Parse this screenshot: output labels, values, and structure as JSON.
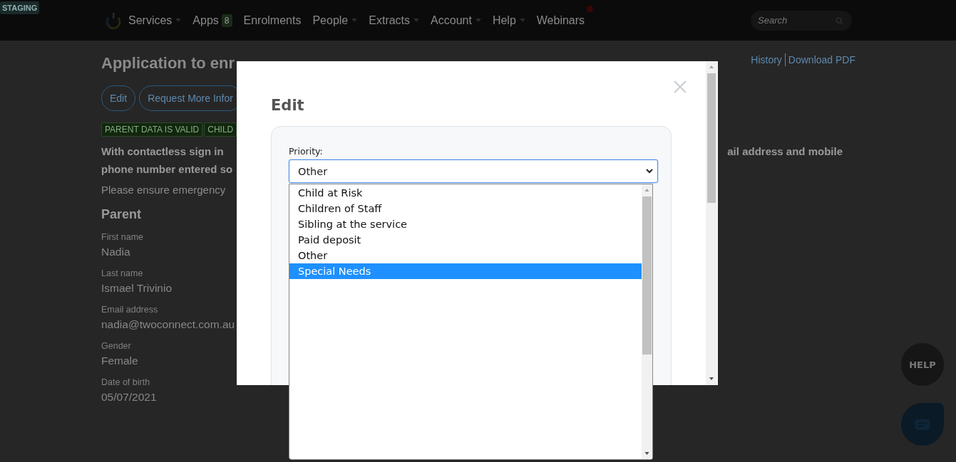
{
  "staging_badge": "STAGING",
  "nav": {
    "items": [
      {
        "label": "Services",
        "kind": "dropdown"
      },
      {
        "label": "Apps",
        "kind": "badge",
        "badge": "8"
      },
      {
        "label": "Enrolments",
        "kind": "link"
      },
      {
        "label": "People",
        "kind": "dropdown"
      },
      {
        "label": "Extracts",
        "kind": "dropdown"
      },
      {
        "label": "Account",
        "kind": "dropdown"
      },
      {
        "label": "Help",
        "kind": "dropdown"
      },
      {
        "label": "Webinars",
        "kind": "notify"
      }
    ],
    "search": {
      "placeholder": "Search"
    }
  },
  "page": {
    "title": "Application to enr",
    "links": [
      "History",
      "Download PDF"
    ],
    "buttons": [
      "Edit",
      "Request More Infor"
    ],
    "badges": [
      "PARENT DATA IS VALID",
      "CHILD"
    ],
    "notice_left": [
      "With contactless sign in",
      "phone number entered so"
    ],
    "notice_right": "ail address and mobile",
    "hint": "Please ensure emergency",
    "section": "Parent",
    "fields": [
      {
        "label": "First name",
        "value": "Nadia"
      },
      {
        "label": "Last name",
        "value": "Ismael Trivinio"
      },
      {
        "label": "Email address",
        "value": "nadia@twoconnect.com.au"
      },
      {
        "label": "Gender",
        "value": "Female"
      },
      {
        "label": "Date of birth",
        "value": "05/07/2021"
      }
    ]
  },
  "help_button": "HELP",
  "modal": {
    "title": "Edit",
    "field": {
      "label": "Priority:",
      "value": "Other",
      "options": [
        {
          "label": "Child at Risk",
          "highlighted": false
        },
        {
          "label": "Children of Staff",
          "highlighted": false
        },
        {
          "label": "Sibling at the service",
          "highlighted": false
        },
        {
          "label": "Paid deposit",
          "highlighted": false
        },
        {
          "label": "Other",
          "highlighted": false
        },
        {
          "label": "Special Needs",
          "highlighted": true
        }
      ]
    }
  }
}
